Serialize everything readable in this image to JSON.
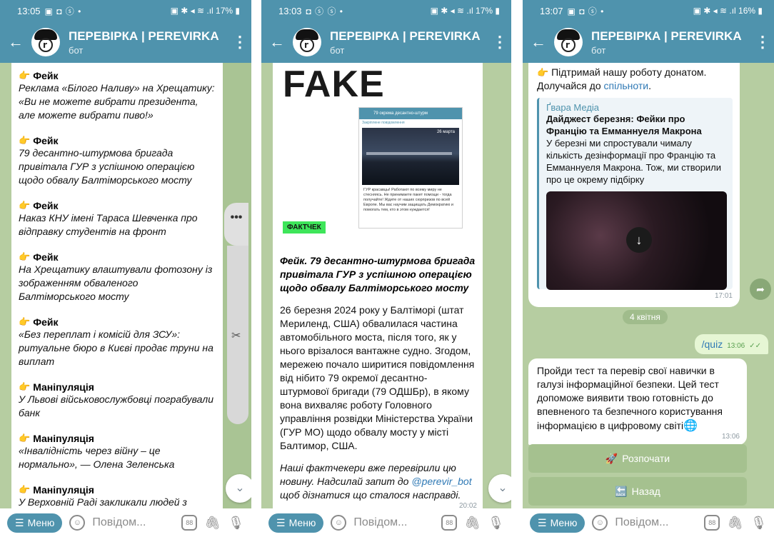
{
  "panel1": {
    "status": {
      "time": "13:05",
      "icons": "▣ ◘ ⓢ •",
      "right": "▣ ✱ ◂ ≋ .ıl 17% ▮"
    },
    "header": {
      "title": "ПЕРЕВІРКА | PEREVIRKA",
      "subtitle": "бот"
    },
    "items": [
      {
        "label": "Фейк",
        "text": "Реклама «Білого Наливу» на Хрещатику: «Ви не можете вибрати президента, але можете вибрати пиво!»"
      },
      {
        "label": "Фейк",
        "text": "79 десантно-штурмова бригада привітала ГУР з успішною операцією щодо обвалу Балтіморського мосту"
      },
      {
        "label": "Фейк",
        "text": "Наказ КНУ імені Тараса Шевченка про відправку студентів на фронт"
      },
      {
        "label": "Фейк",
        "text": "На Хрещатику влаштували фотозону із зображенням обваленого Балтіморського мосту"
      },
      {
        "label": "Фейк",
        "text": "«Без переплат і комісій для ЗСУ»: ритуальне бюро в Києві продає труни на виплат"
      },
      {
        "label": "Маніпуляція",
        "text": "У Львові військовослужбовці пограбували банк"
      },
      {
        "label": "Маніпуляція",
        "text": "«Інвалідність через війну – це нормально», — Олена Зеленська"
      },
      {
        "label": "Маніпуляція",
        "text": "У Верховній Раді закликали людей з інвалідністю готуватися до мобілізації"
      }
    ],
    "dots": "•••",
    "bottom": {
      "menu": "Меню",
      "placeholder": "Повідом..."
    }
  },
  "panel2": {
    "status": {
      "time": "13:03",
      "icons": "◘ ⓢ ⓢ •",
      "right": "▣ ✱ ◂ ≋ .ıl 17% ▮"
    },
    "header": {
      "title": "ПЕРЕВІРКА | PEREVIRKA",
      "subtitle": "бот"
    },
    "image": {
      "fake": "FAKE",
      "shot_title": "79 окрема десантно-штурм",
      "shot_pinned": "Закріплене повідомлення",
      "shot_date": "26 марта",
      "shot_text": "ГУР красавцы! Работают по всему миру не стесняясь. Не принимаете пакет помощи - тогда получайте! Ждите от наших сюрпризов по всей Европе. Мы вас научим защищать Демократию и помогать тем, кто в этом нуждается!",
      "badge": "ФАКТЧЕК"
    },
    "title": "Фейк. 79 десантно-штурмова бригада привітала ГУР з успішною операцією щодо обвалу Балтіморського мосту",
    "body": "26 березня 2024 року у Балтіморі (штат Мериленд, США) обвалилася частина автомобільного моста, після того, як у нього врізалося вантажне судно. Згодом, мережею почало ширитися повідомлення від нібито 79 окремої десантно-штурмової бригади (79 ОДШБр), в якому вона вихваляє роботу Головного управління розвідки Міністерства України (ГУР МО) щодо обвалу мосту у місті Балтимор, США.",
    "ital_pre": "Наші фактчекери вже перевірили цю новину. Надсилай запит до ",
    "ital_link": "@perevir_bot",
    "ital_post": " щоб дізнатися що сталося насправді.",
    "time": "20:02",
    "bottom": {
      "menu": "Меню",
      "placeholder": "Повідом..."
    }
  },
  "panel3": {
    "status": {
      "time": "13:07",
      "icons": "▣ ◘ ⓢ •",
      "right": "▣ ✱ ◂ ≋ .ıl 16% ▮"
    },
    "header": {
      "title": "ПЕРЕВІРКА | PEREVIRKA",
      "subtitle": "бот"
    },
    "top_text_pre": "Підтримай нашу роботу донатом. Долучайся до ",
    "top_link": "спільноти",
    "top_text_post": ".",
    "reply": {
      "source": "Ґвара Медіа",
      "title": "Дайджест березня: Фейки про Францію та Емманнуеля Макрона",
      "text": "У березні ми спростували чималу кількість дезінформації про Францію та Емманнуеля Макрона. Тож, ми створили про це окрему підбірку"
    },
    "msg_time1": "17:01",
    "date_pill": "4 квітня",
    "out": {
      "text": "/quiz",
      "time": "13:06",
      "checks": "✓✓"
    },
    "in_text": "Пройди тест та перевір свої навички в галузі інформаційної безпеки. Цей тест допоможе виявити твою готовність до впевненого та безпечного користування інформацією в цифровому світі",
    "in_time": "13:06",
    "btn_start": "Розпочати",
    "btn_back": "Назад",
    "bottom": {
      "menu": "Меню",
      "placeholder": "Повідом..."
    }
  }
}
